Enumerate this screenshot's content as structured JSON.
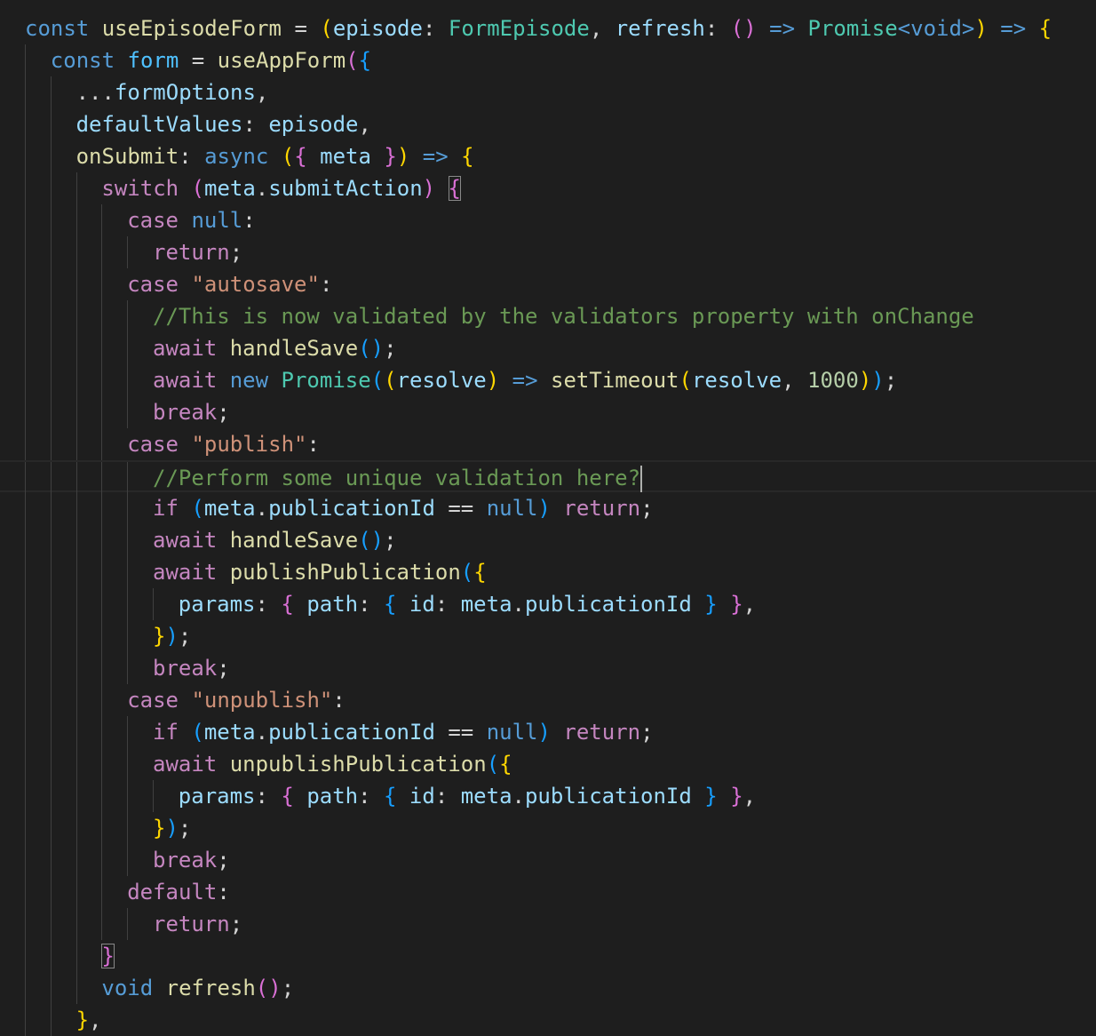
{
  "editor": {
    "language": "typescript",
    "theme": {
      "background": "#1e1e1e",
      "keyword": "#569cd6",
      "control": "#c586c0",
      "function": "#dcdcaa",
      "variable": "#9cdcfe",
      "constant": "#4fc1ff",
      "type": "#4ec9b0",
      "string": "#ce9178",
      "number": "#b5cea8",
      "comment": "#6a9955",
      "punctuation": "#d4d4d4",
      "bracket_level_1": "#ffd700",
      "bracket_level_2": "#da70d6",
      "bracket_level_3": "#179fff"
    },
    "lines": [
      {
        "indent": 0,
        "tokens": [
          {
            "t": "const",
            "c": "kw"
          },
          {
            "t": " "
          },
          {
            "t": "useEpisodeForm",
            "c": "fn"
          },
          {
            "t": " = "
          },
          {
            "t": "(",
            "c": "br1"
          },
          {
            "t": "episode",
            "c": "var"
          },
          {
            "t": ": "
          },
          {
            "t": "FormEpisode",
            "c": "type"
          },
          {
            "t": ", "
          },
          {
            "t": "refresh",
            "c": "var"
          },
          {
            "t": ": "
          },
          {
            "t": "()",
            "c": "br2"
          },
          {
            "t": " "
          },
          {
            "t": "=>",
            "c": "kw"
          },
          {
            "t": " "
          },
          {
            "t": "Promise",
            "c": "type"
          },
          {
            "t": "<",
            "c": "kw"
          },
          {
            "t": "void",
            "c": "kw"
          },
          {
            "t": ">",
            "c": "kw"
          },
          {
            "t": ")",
            "c": "br1"
          },
          {
            "t": " "
          },
          {
            "t": "=>",
            "c": "kw"
          },
          {
            "t": " "
          },
          {
            "t": "{",
            "c": "br1"
          }
        ]
      },
      {
        "indent": 1,
        "tokens": [
          {
            "t": "const",
            "c": "kw"
          },
          {
            "t": " "
          },
          {
            "t": "form",
            "c": "cst"
          },
          {
            "t": " = "
          },
          {
            "t": "useAppForm",
            "c": "fn"
          },
          {
            "t": "(",
            "c": "br2"
          },
          {
            "t": "{",
            "c": "br3"
          }
        ]
      },
      {
        "indent": 2,
        "tokens": [
          {
            "t": "..."
          },
          {
            "t": "formOptions",
            "c": "var"
          },
          {
            "t": ","
          }
        ]
      },
      {
        "indent": 2,
        "tokens": [
          {
            "t": "defaultValues",
            "c": "var"
          },
          {
            "t": ": "
          },
          {
            "t": "episode",
            "c": "var"
          },
          {
            "t": ","
          }
        ]
      },
      {
        "indent": 2,
        "tokens": [
          {
            "t": "onSubmit",
            "c": "fn"
          },
          {
            "t": ": "
          },
          {
            "t": "async",
            "c": "kw"
          },
          {
            "t": " "
          },
          {
            "t": "(",
            "c": "br1"
          },
          {
            "t": "{",
            "c": "br2"
          },
          {
            "t": " "
          },
          {
            "t": "meta",
            "c": "var"
          },
          {
            "t": " "
          },
          {
            "t": "}",
            "c": "br2"
          },
          {
            "t": ")",
            "c": "br1"
          },
          {
            "t": " "
          },
          {
            "t": "=>",
            "c": "kw"
          },
          {
            "t": " "
          },
          {
            "t": "{",
            "c": "br1"
          }
        ]
      },
      {
        "indent": 3,
        "tokens": [
          {
            "t": "switch",
            "c": "ctl"
          },
          {
            "t": " "
          },
          {
            "t": "(",
            "c": "br2"
          },
          {
            "t": "meta",
            "c": "var"
          },
          {
            "t": "."
          },
          {
            "t": "submitAction",
            "c": "var"
          },
          {
            "t": ")",
            "c": "br2"
          },
          {
            "t": " "
          },
          {
            "t": "{",
            "c": "br2",
            "m": 1
          }
        ]
      },
      {
        "indent": 4,
        "tokens": [
          {
            "t": "case",
            "c": "ctl"
          },
          {
            "t": " "
          },
          {
            "t": "null",
            "c": "kw"
          },
          {
            "t": ":"
          }
        ]
      },
      {
        "indent": 5,
        "tokens": [
          {
            "t": "return",
            "c": "ctl"
          },
          {
            "t": ";"
          }
        ]
      },
      {
        "indent": 4,
        "tokens": [
          {
            "t": "case",
            "c": "ctl"
          },
          {
            "t": " "
          },
          {
            "t": "\"autosave\"",
            "c": "str"
          },
          {
            "t": ":"
          }
        ]
      },
      {
        "indent": 5,
        "tokens": [
          {
            "t": "//This is now validated by the validators property with onChange",
            "c": "cmt"
          }
        ]
      },
      {
        "indent": 5,
        "tokens": [
          {
            "t": "await",
            "c": "ctl"
          },
          {
            "t": " "
          },
          {
            "t": "handleSave",
            "c": "fn"
          },
          {
            "t": "()",
            "c": "br3"
          },
          {
            "t": ";"
          }
        ]
      },
      {
        "indent": 5,
        "tokens": [
          {
            "t": "await",
            "c": "ctl"
          },
          {
            "t": " "
          },
          {
            "t": "new",
            "c": "kw"
          },
          {
            "t": " "
          },
          {
            "t": "Promise",
            "c": "type"
          },
          {
            "t": "(",
            "c": "br3"
          },
          {
            "t": "(",
            "c": "br1"
          },
          {
            "t": "resolve",
            "c": "var"
          },
          {
            "t": ")",
            "c": "br1"
          },
          {
            "t": " "
          },
          {
            "t": "=>",
            "c": "kw"
          },
          {
            "t": " "
          },
          {
            "t": "setTimeout",
            "c": "fn"
          },
          {
            "t": "(",
            "c": "br1"
          },
          {
            "t": "resolve",
            "c": "var"
          },
          {
            "t": ", "
          },
          {
            "t": "1000",
            "c": "num"
          },
          {
            "t": ")",
            "c": "br1"
          },
          {
            "t": ")",
            "c": "br3"
          },
          {
            "t": ";"
          }
        ]
      },
      {
        "indent": 5,
        "tokens": [
          {
            "t": "break",
            "c": "ctl"
          },
          {
            "t": ";"
          }
        ]
      },
      {
        "indent": 4,
        "tokens": [
          {
            "t": "case",
            "c": "ctl"
          },
          {
            "t": " "
          },
          {
            "t": "\"publish\"",
            "c": "str"
          },
          {
            "t": ":"
          }
        ]
      },
      {
        "indent": 5,
        "current": true,
        "caret": true,
        "tokens": [
          {
            "t": "//Perform some unique validation here?",
            "c": "cmt"
          }
        ]
      },
      {
        "indent": 5,
        "tokens": [
          {
            "t": "if",
            "c": "ctl"
          },
          {
            "t": " "
          },
          {
            "t": "(",
            "c": "br3"
          },
          {
            "t": "meta",
            "c": "var"
          },
          {
            "t": "."
          },
          {
            "t": "publicationId",
            "c": "var"
          },
          {
            "t": " == "
          },
          {
            "t": "null",
            "c": "kw"
          },
          {
            "t": ")",
            "c": "br3"
          },
          {
            "t": " "
          },
          {
            "t": "return",
            "c": "ctl"
          },
          {
            "t": ";"
          }
        ]
      },
      {
        "indent": 5,
        "tokens": [
          {
            "t": "await",
            "c": "ctl"
          },
          {
            "t": " "
          },
          {
            "t": "handleSave",
            "c": "fn"
          },
          {
            "t": "()",
            "c": "br3"
          },
          {
            "t": ";"
          }
        ]
      },
      {
        "indent": 5,
        "tokens": [
          {
            "t": "await",
            "c": "ctl"
          },
          {
            "t": " "
          },
          {
            "t": "publishPublication",
            "c": "fn"
          },
          {
            "t": "(",
            "c": "br3"
          },
          {
            "t": "{",
            "c": "br1"
          }
        ]
      },
      {
        "indent": 6,
        "tokens": [
          {
            "t": "params",
            "c": "var"
          },
          {
            "t": ": "
          },
          {
            "t": "{",
            "c": "br2"
          },
          {
            "t": " "
          },
          {
            "t": "path",
            "c": "var"
          },
          {
            "t": ": "
          },
          {
            "t": "{",
            "c": "br3"
          },
          {
            "t": " "
          },
          {
            "t": "id",
            "c": "var"
          },
          {
            "t": ": "
          },
          {
            "t": "meta",
            "c": "var"
          },
          {
            "t": "."
          },
          {
            "t": "publicationId",
            "c": "var"
          },
          {
            "t": " "
          },
          {
            "t": "}",
            "c": "br3"
          },
          {
            "t": " "
          },
          {
            "t": "}",
            "c": "br2"
          },
          {
            "t": ","
          }
        ]
      },
      {
        "indent": 5,
        "tokens": [
          {
            "t": "}",
            "c": "br1"
          },
          {
            "t": ")",
            "c": "br3"
          },
          {
            "t": ";"
          }
        ]
      },
      {
        "indent": 5,
        "tokens": [
          {
            "t": "break",
            "c": "ctl"
          },
          {
            "t": ";"
          }
        ]
      },
      {
        "indent": 4,
        "tokens": [
          {
            "t": "case",
            "c": "ctl"
          },
          {
            "t": " "
          },
          {
            "t": "\"unpublish\"",
            "c": "str"
          },
          {
            "t": ":"
          }
        ]
      },
      {
        "indent": 5,
        "tokens": [
          {
            "t": "if",
            "c": "ctl"
          },
          {
            "t": " "
          },
          {
            "t": "(",
            "c": "br3"
          },
          {
            "t": "meta",
            "c": "var"
          },
          {
            "t": "."
          },
          {
            "t": "publicationId",
            "c": "var"
          },
          {
            "t": " == "
          },
          {
            "t": "null",
            "c": "kw"
          },
          {
            "t": ")",
            "c": "br3"
          },
          {
            "t": " "
          },
          {
            "t": "return",
            "c": "ctl"
          },
          {
            "t": ";"
          }
        ]
      },
      {
        "indent": 5,
        "tokens": [
          {
            "t": "await",
            "c": "ctl"
          },
          {
            "t": " "
          },
          {
            "t": "unpublishPublication",
            "c": "fn"
          },
          {
            "t": "(",
            "c": "br3"
          },
          {
            "t": "{",
            "c": "br1"
          }
        ]
      },
      {
        "indent": 6,
        "tokens": [
          {
            "t": "params",
            "c": "var"
          },
          {
            "t": ": "
          },
          {
            "t": "{",
            "c": "br2"
          },
          {
            "t": " "
          },
          {
            "t": "path",
            "c": "var"
          },
          {
            "t": ": "
          },
          {
            "t": "{",
            "c": "br3"
          },
          {
            "t": " "
          },
          {
            "t": "id",
            "c": "var"
          },
          {
            "t": ": "
          },
          {
            "t": "meta",
            "c": "var"
          },
          {
            "t": "."
          },
          {
            "t": "publicationId",
            "c": "var"
          },
          {
            "t": " "
          },
          {
            "t": "}",
            "c": "br3"
          },
          {
            "t": " "
          },
          {
            "t": "}",
            "c": "br2"
          },
          {
            "t": ","
          }
        ]
      },
      {
        "indent": 5,
        "tokens": [
          {
            "t": "}",
            "c": "br1"
          },
          {
            "t": ")",
            "c": "br3"
          },
          {
            "t": ";"
          }
        ]
      },
      {
        "indent": 5,
        "tokens": [
          {
            "t": "break",
            "c": "ctl"
          },
          {
            "t": ";"
          }
        ]
      },
      {
        "indent": 4,
        "tokens": [
          {
            "t": "default",
            "c": "ctl"
          },
          {
            "t": ":"
          }
        ]
      },
      {
        "indent": 5,
        "tokens": [
          {
            "t": "return",
            "c": "ctl"
          },
          {
            "t": ";"
          }
        ]
      },
      {
        "indent": 3,
        "tokens": [
          {
            "t": "}",
            "c": "br2",
            "m": 1
          }
        ]
      },
      {
        "indent": 3,
        "tokens": [
          {
            "t": "void",
            "c": "kw"
          },
          {
            "t": " "
          },
          {
            "t": "refresh",
            "c": "fn"
          },
          {
            "t": "()",
            "c": "br2"
          },
          {
            "t": ";"
          }
        ]
      },
      {
        "indent": 2,
        "tokens": [
          {
            "t": "}",
            "c": "br1"
          },
          {
            "t": ","
          }
        ]
      }
    ]
  }
}
